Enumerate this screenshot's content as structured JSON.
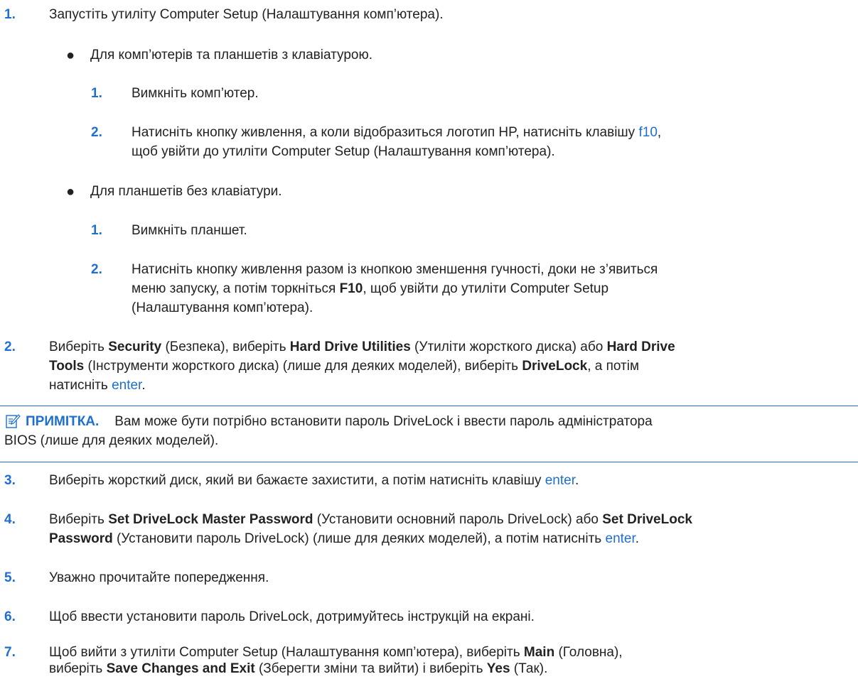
{
  "steps": {
    "s1": {
      "num": "1.",
      "text": "Запустіть утиліту Computer Setup (Налаштування комп’ютера).",
      "keyboard": {
        "bullet": "●",
        "text": "Для комп’ютерів та планшетів з клавіатурою.",
        "a_num": "1.",
        "a_text": "Вимкніть комп’ютер.",
        "b_num": "2.",
        "b_text1": "Натисніть кнопку живлення, а коли відобразиться логотип HP, натисніть клавішу ",
        "b_key": "f10",
        "b_text1_end": ",",
        "b_text2": "щоб увійти до утиліти Computer Setup (Налаштування комп’ютера)."
      },
      "nokeyboard": {
        "bullet": "●",
        "text": "Для планшетів без клавіатури.",
        "a_num": "1.",
        "a_text": "Вимкніть планшет.",
        "b_num": "2.",
        "b_line1": "Натисніть кнопку живлення разом із кнопкою зменшення гучності, доки не з’явиться",
        "b_line2a": "меню запуску, а потім торкніться ",
        "b_line2_bold": "F10",
        "b_line2b": ", щоб увійти до утиліти Computer Setup",
        "b_line3": "(Налаштування комп’ютера)."
      }
    },
    "s2": {
      "num": "2.",
      "l1a": "Виберіть ",
      "l1_security": "Security",
      "l1b": " (Безпека), виберіть ",
      "l1_hdu": "Hard Drive Utilities",
      "l1c": " (Утиліти жорсткого диска) або ",
      "l1_hard_drive": "Hard Drive",
      "l2_tools": "Tools",
      "l2a": " (Інструменти жорсткого диска) (лише для деяких моделей), виберіть ",
      "l2_drivelock": "DriveLock",
      "l2b": ", а потім",
      "l3a": "натисніть ",
      "l3_key": "enter",
      "l3b": "."
    },
    "note": {
      "label": "ПРИМІТКА.",
      "line1": "Вам може бути потрібно встановити пароль DriveLock і ввести пароль адміністратора",
      "line2": "BIOS (лише для деяких моделей)."
    },
    "s3": {
      "num": "3.",
      "text": "Виберіть жорсткий диск, який ви бажаєте захистити, а потім натисніть клавішу ",
      "key": "enter",
      "end": "."
    },
    "s4": {
      "num": "4.",
      "l1a": "Виберіть ",
      "l1_bold1": "Set DriveLock Master Password",
      "l1b": " (Установити основний пароль DriveLock) або ",
      "l1_bold2": "Set DriveLock",
      "l2_bold": "Password",
      "l2a": " (Установити пароль DriveLock) (лише для деяких моделей), а потім натисніть ",
      "l2_key": "enter",
      "l2b": "."
    },
    "s5": {
      "num": "5.",
      "text": "Уважно прочитайте попередження."
    },
    "s6": {
      "num": "6.",
      "text": "Щоб ввести установити пароль DriveLock, дотримуйтесь інструкцій на екрані."
    },
    "s7": {
      "num": "7.",
      "l1a": "Щоб вийти з утиліти Computer Setup (Налаштування комп’ютера), виберіть ",
      "l1_main": "Main",
      "l1b": " (Головна),",
      "l2a": "виберіть ",
      "l2_save": "Save Changes and Exit",
      "l2b": " (Зберегти зміни та вийти) і виберіть ",
      "l2_yes": "Yes",
      "l2c": " (Так)."
    }
  }
}
